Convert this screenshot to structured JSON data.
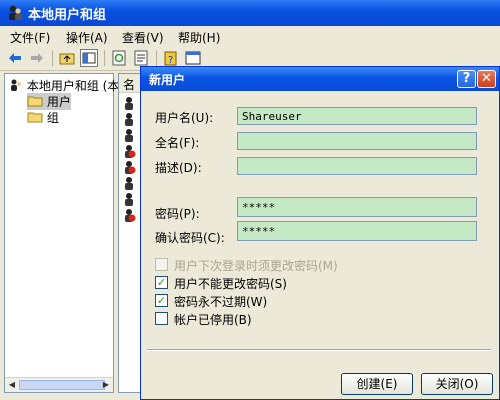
{
  "window": {
    "title": "本地用户和组",
    "menu": [
      "文件(F)",
      "操作(A)",
      "查看(V)",
      "帮助(H)"
    ]
  },
  "tree": {
    "root": "本地用户和组 (本",
    "items": [
      "用户",
      "组"
    ]
  },
  "list": {
    "header": "名",
    "row_count": 8
  },
  "dialog": {
    "title": "新用户",
    "fields": {
      "username_label": "用户名(U):",
      "username_value": "Shareuser",
      "fullname_label": "全名(F):",
      "fullname_value": "",
      "description_label": "描述(D):",
      "description_value": "",
      "password_label": "密码(P):",
      "password_value": "*****",
      "confirm_label": "确认密码(C):",
      "confirm_value": "*****"
    },
    "checkboxes": {
      "must_change": {
        "label": "用户下次登录时须更改密码(M)",
        "checked": false,
        "enabled": false
      },
      "cannot_change": {
        "label": "用户不能更改密码(S)",
        "checked": true,
        "enabled": true
      },
      "never_expires": {
        "label": "密码永不过期(W)",
        "checked": true,
        "enabled": true
      },
      "disabled": {
        "label": "帐户已停用(B)",
        "checked": false,
        "enabled": true
      }
    },
    "buttons": {
      "create": "创建(E)",
      "close": "关闭(O)"
    },
    "caption_help": "?",
    "caption_close": "✕"
  },
  "colors": {
    "titlebar": "#0a52e0",
    "field_bg": "#c5e8c5",
    "face": "#ece9d8"
  }
}
